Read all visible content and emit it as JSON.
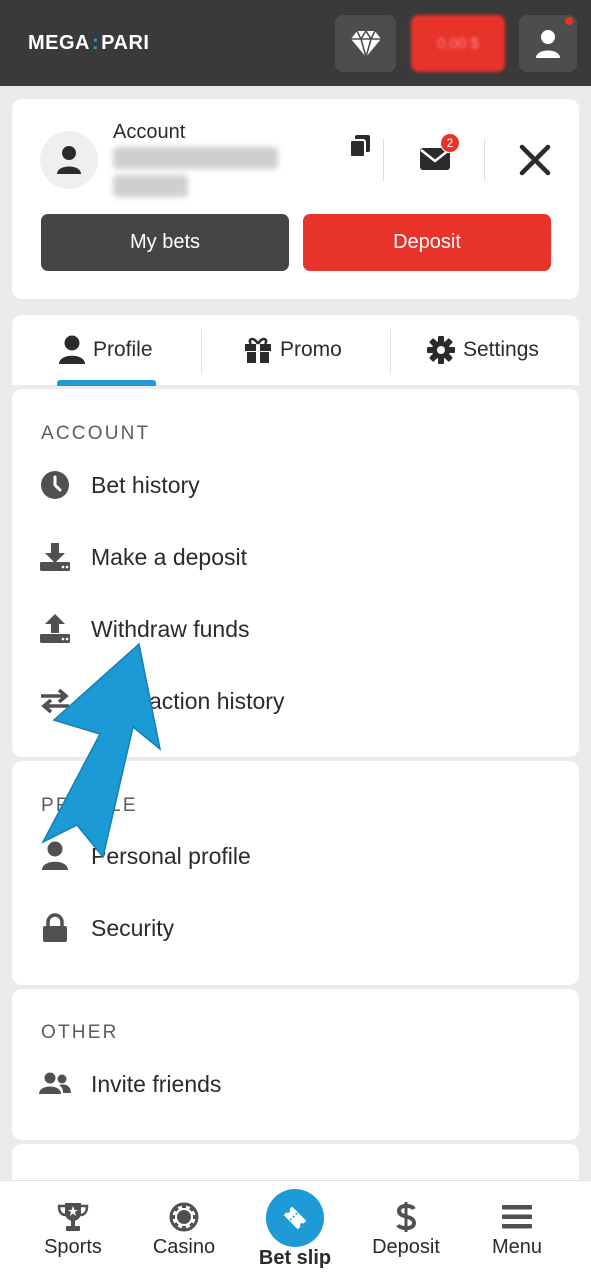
{
  "header": {
    "logo_left": "MEGA",
    "logo_sep": ":",
    "logo_right": "PARI",
    "balance": "0.00 $"
  },
  "account": {
    "label": "Account",
    "id_masked": "ID 1779532",
    "sub_masked": "0.00 $",
    "messages_count": "2",
    "my_bets_label": "My bets",
    "deposit_label": "Deposit"
  },
  "tabs": [
    {
      "label": "Profile",
      "icon": "user-icon",
      "active": true
    },
    {
      "label": "Promo",
      "icon": "gift-icon"
    },
    {
      "label": "Settings",
      "icon": "gear-icon"
    }
  ],
  "sections": {
    "account": {
      "title": "ACCOUNT",
      "items": [
        {
          "label": "Bet history",
          "icon": "clock-icon"
        },
        {
          "label": "Make a deposit",
          "icon": "download-icon"
        },
        {
          "label": "Withdraw funds",
          "icon": "upload-icon"
        },
        {
          "label": "Transaction history",
          "icon": "transfer-icon"
        }
      ]
    },
    "profile": {
      "title": "PROFILE",
      "items": [
        {
          "label": "Personal profile",
          "icon": "person-icon"
        },
        {
          "label": "Security",
          "icon": "lock-icon"
        }
      ]
    },
    "other": {
      "title": "OTHER",
      "items": [
        {
          "label": "Invite friends",
          "icon": "people-icon"
        }
      ]
    }
  },
  "bottom_nav": [
    {
      "label": "Sports",
      "icon": "trophy-icon"
    },
    {
      "label": "Casino",
      "icon": "chip-icon"
    },
    {
      "label": "Bet slip",
      "icon": "ticket-icon"
    },
    {
      "label": "Deposit",
      "icon": "dollar-icon"
    },
    {
      "label": "Menu",
      "icon": "hamburger-icon"
    }
  ],
  "colors": {
    "topbar": "#3a3a3a",
    "accent_red": "#e8332b",
    "accent_blue": "#1e9bd7",
    "background": "#ebebeb"
  }
}
